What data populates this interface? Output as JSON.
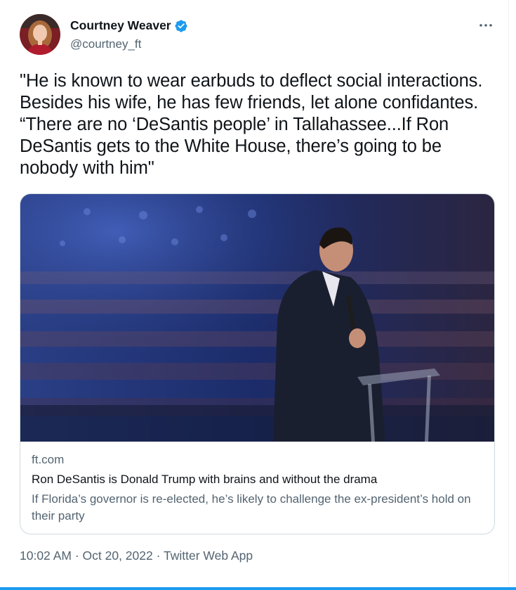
{
  "author": {
    "display_name": "Courtney Weaver",
    "handle": "@courtney_ft",
    "verified_icon": "verified-badge-icon",
    "avatar_icon": "profile-photo"
  },
  "more_menu_icon": "more-horizontal-icon",
  "tweet": {
    "text": "\"He is known to wear earbuds to deflect social interactions. Besides his wife, he has few friends, let alone confidantes. “There are no ‘DeSantis people’ in Tallahassee...If Ron DeSantis gets to the White House, there’s going to be nobody with him\""
  },
  "card": {
    "domain": "ft.com",
    "title": "Ron DeSantis is Donald Trump with brains and without the drama",
    "description": "If Florida’s governor is re-elected, he’s likely to challenge the ex-president’s hold on their party"
  },
  "meta": {
    "time": "10:02 AM",
    "separator": "·",
    "date": "Oct 20, 2022",
    "source": "Twitter Web App"
  },
  "colors": {
    "verified": "#1d9bf0",
    "secondary_text": "#536471",
    "border": "#cfd9de"
  }
}
